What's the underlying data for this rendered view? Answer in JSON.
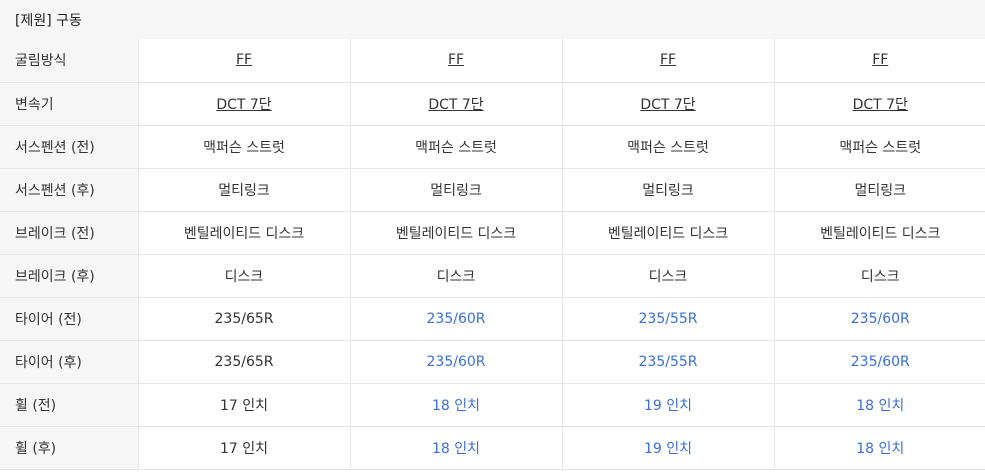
{
  "header": {
    "title": "[제원] 구동"
  },
  "colors": {
    "highlight": "#3a6fd8",
    "label_bg": "#f6f6f6",
    "border": "#e5e5e5"
  },
  "rows": [
    {
      "label": "굴림방식",
      "values": [
        "FF",
        "FF",
        "FF",
        "FF"
      ]
    },
    {
      "label": "변속기",
      "values": [
        "DCT 7단",
        "DCT 7단",
        "DCT 7단",
        "DCT 7단"
      ]
    },
    {
      "label": "서스펜션 (전)",
      "values": [
        "맥퍼슨 스트럿",
        "맥퍼슨 스트럿",
        "맥퍼슨 스트럿",
        "맥퍼슨 스트럿"
      ]
    },
    {
      "label": "서스펜션 (후)",
      "values": [
        "멀티링크",
        "멀티링크",
        "멀티링크",
        "멀티링크"
      ]
    },
    {
      "label": "브레이크 (전)",
      "values": [
        "벤틸레이티드 디스크",
        "벤틸레이티드 디스크",
        "벤틸레이티드 디스크",
        "벤틸레이티드 디스크"
      ]
    },
    {
      "label": "브레이크 (후)",
      "values": [
        "디스크",
        "디스크",
        "디스크",
        "디스크"
      ]
    },
    {
      "label": "타이어 (전)",
      "values": [
        "235/65R",
        "235/60R",
        "235/55R",
        "235/60R"
      ]
    },
    {
      "label": "타이어 (후)",
      "values": [
        "235/65R",
        "235/60R",
        "235/55R",
        "235/60R"
      ]
    },
    {
      "label": "휠 (전)",
      "values": [
        "17 인치",
        "18 인치",
        "19 인치",
        "18 인치"
      ]
    },
    {
      "label": "휠 (후)",
      "values": [
        "17 인치",
        "18 인치",
        "19 인치",
        "18 인치"
      ]
    }
  ]
}
